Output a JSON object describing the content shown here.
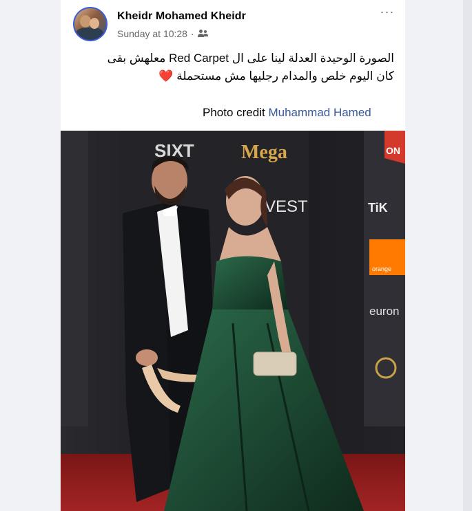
{
  "post": {
    "author": "Kheidr Mohamed Kheidr",
    "time": "Sunday at 10:28",
    "separator": "·",
    "more_label": "···",
    "caption_line1": "الصورة الوحيدة العدلة لينا على ال Red Carpet معلهش بقى",
    "caption_line2": "كان اليوم خلص والمدام رجليها مش مستحملة",
    "heart": "❤️",
    "credit_prefix": "Photo credit",
    "credit_name": "Muhammad Hamed"
  },
  "photo": {
    "backdrop_logos": {
      "sixt": "SIXT",
      "mega": "Mega",
      "vest": "VEST",
      "tiktok": "TiK",
      "orange": "orange",
      "euronews": "euron",
      "on": "ON"
    }
  },
  "icons": {
    "audience": "friends-icon",
    "more": "more-options-icon"
  },
  "colors": {
    "link": "#385898",
    "meta": "#65676b",
    "avatar_ring": "#3b5bdb",
    "dress": "#1f4d35",
    "carpet": "#8f1e1e"
  }
}
